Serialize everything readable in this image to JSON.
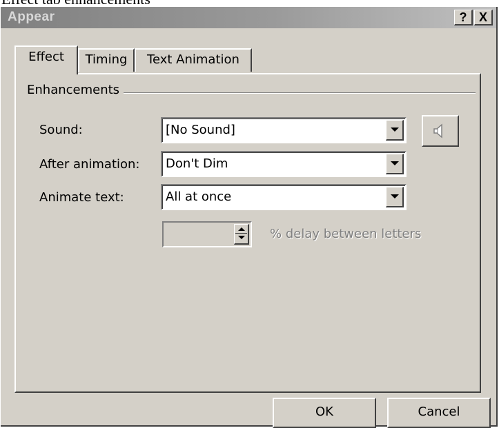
{
  "document": {
    "caption": "Effect tab enhancements"
  },
  "window": {
    "title": "Appear",
    "help_button": "?",
    "close_button": "X"
  },
  "tabs": [
    {
      "label": "Effect",
      "active": true
    },
    {
      "label": "Timing",
      "active": false
    },
    {
      "label": "Text Animation",
      "active": false
    }
  ],
  "enhancements": {
    "group_label": "Enhancements",
    "sound": {
      "label": "Sound:",
      "value": "[No Sound]"
    },
    "after_animation": {
      "label": "After animation:",
      "value": "Don't Dim"
    },
    "animate_text": {
      "label": "Animate text:",
      "value": "All at once"
    },
    "delay": {
      "value": "",
      "label": "% delay between letters",
      "enabled": false
    },
    "sound_settings_icon": "speaker-icon"
  },
  "footer": {
    "ok_label": "OK",
    "cancel_label": "Cancel"
  },
  "colors": {
    "face": "#d4d0c8",
    "title_gradient_start": "#808080",
    "title_gradient_end": "#c0c0c0",
    "disabled_text": "#808080"
  }
}
